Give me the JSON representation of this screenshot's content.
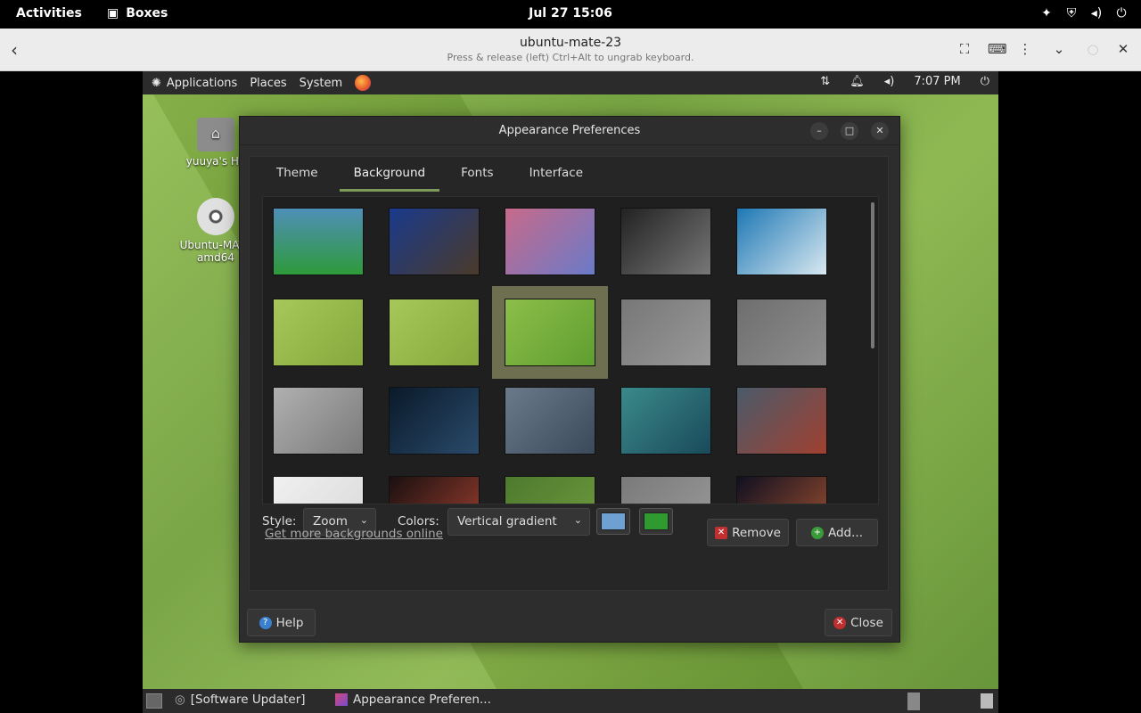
{
  "gnome_bar": {
    "activities": "Activities",
    "app_name": "Boxes",
    "clock": "Jul 27  15:06",
    "tray_icons": [
      "accessibility-icon",
      "shield-icon",
      "volume-icon",
      "power-icon"
    ]
  },
  "boxes_header": {
    "title": "ubuntu-mate-23",
    "subtitle": "Press & release (left) Ctrl+Alt to ungrab keyboard."
  },
  "mate_panel": {
    "applications": "Applications",
    "places": "Places",
    "system": "System",
    "clock": "7:07 PM"
  },
  "desktop": {
    "home_icon_label": "yuuya's Ho",
    "disc_icon_label_1": "Ubuntu-MATE",
    "disc_icon_label_2": "amd64"
  },
  "dialog": {
    "title": "Appearance Preferences",
    "tabs": [
      "Theme",
      "Background",
      "Fonts",
      "Interface"
    ],
    "active_tab": "Background",
    "style_label": "Style:",
    "style_value": "Zoom",
    "colors_label": "Colors:",
    "colors_value": "Vertical gradient",
    "color_primary": "#6ea0d2",
    "color_secondary": "#2f9a2f",
    "more_link": "Get more backgrounds online",
    "remove_button": "Remove",
    "add_button": "Add...",
    "help_button": "Help",
    "close_button": "Close",
    "thumbnails": [
      {
        "name": "vertical-gradient",
        "colors": [
          "#4f8fb8",
          "#2e9a3a"
        ]
      },
      {
        "name": "blue-crayfish",
        "colors": [
          "#1a3a8c",
          "#4a3a2a"
        ]
      },
      {
        "name": "bokeh-lights",
        "colors": [
          "#c86a8a",
          "#6a7ac8"
        ]
      },
      {
        "name": "spiral-galaxy",
        "colors": [
          "#222222",
          "#777777"
        ]
      },
      {
        "name": "ice-waves",
        "colors": [
          "#1e78b4",
          "#d8e8f0"
        ]
      },
      {
        "name": "green-polygons",
        "colors": [
          "#a6c85a",
          "#86a83c"
        ]
      },
      {
        "name": "green-polygons-logo",
        "colors": [
          "#a6c85a",
          "#86a83c"
        ]
      },
      {
        "name": "green-geometric-logo",
        "colors": [
          "#8dbe4a",
          "#5f9e2f"
        ]
      },
      {
        "name": "gray-polygons",
        "colors": [
          "#777777",
          "#999999"
        ]
      },
      {
        "name": "gray-polygons-logo",
        "colors": [
          "#6e6e6e",
          "#8e8e8e"
        ]
      },
      {
        "name": "silver-geometric-logo",
        "colors": [
          "#b0b0b0",
          "#7a7a7a"
        ]
      },
      {
        "name": "earth-night",
        "colors": [
          "#0a1a2a",
          "#2a4a6a"
        ]
      },
      {
        "name": "mountain-valley",
        "colors": [
          "#6a7a8a",
          "#3a4a5a"
        ]
      },
      {
        "name": "teal-wave",
        "colors": [
          "#3a8a8a",
          "#1a4a5a"
        ]
      },
      {
        "name": "space-crab",
        "colors": [
          "#4a5a6a",
          "#a04030"
        ]
      },
      {
        "name": "white-sheet",
        "colors": [
          "#f0f0f0",
          "#d8d8d8"
        ]
      },
      {
        "name": "red-planet",
        "colors": [
          "#1a1010",
          "#a04030"
        ]
      },
      {
        "name": "green-field",
        "colors": [
          "#4e7a2e",
          "#6e9a3e"
        ]
      },
      {
        "name": "gray-field",
        "colors": [
          "#7a7a7a",
          "#9a9a9a"
        ]
      },
      {
        "name": "space-ship",
        "colors": [
          "#101020",
          "#a05030"
        ]
      }
    ]
  },
  "bottom_panel": {
    "task_1": "[Software Updater]",
    "task_2": "Appearance Preferen..."
  }
}
